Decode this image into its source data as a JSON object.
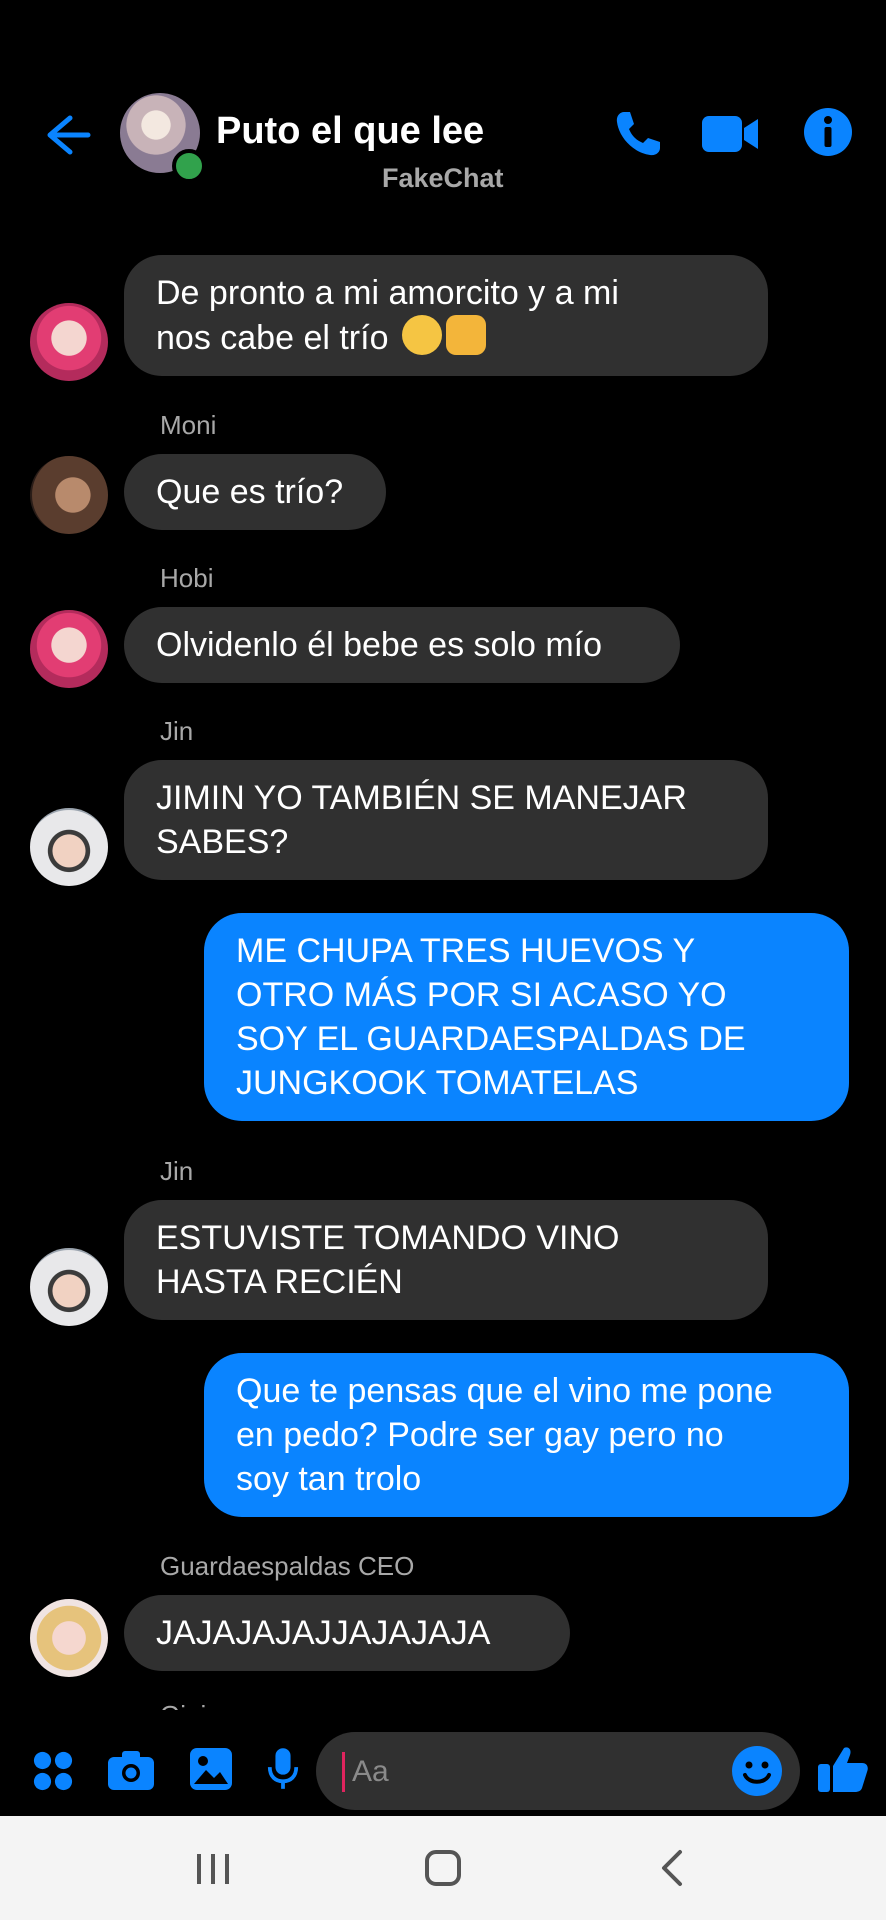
{
  "header": {
    "title": "Puto el que lee",
    "subtitle": "FakeChat"
  },
  "messages": [
    {
      "dir": "in",
      "sender": "",
      "lines": [
        "De pronto a mi amorcito y a mi",
        "nos cabe el trío"
      ],
      "emoji": [
        "pensive-face",
        "raised-fist"
      ]
    },
    {
      "dir": "in",
      "sender": "Moni",
      "lines": [
        "Que es trío?"
      ]
    },
    {
      "dir": "in",
      "sender": "Hobi",
      "lines": [
        "Olvidenlo él bebe es solo mío"
      ]
    },
    {
      "dir": "in",
      "sender": "Jin",
      "lines": [
        "JIMIN YO TAMBIÉN SE MANEJAR",
        "SABES?"
      ]
    },
    {
      "dir": "out",
      "lines": [
        "ME CHUPA TRES HUEVOS Y",
        "OTRO MÁS POR SI ACASO YO",
        "SOY EL GUARDAESPALDAS DE",
        "JUNGKOOK TOMATELAS"
      ]
    },
    {
      "dir": "in",
      "sender": "Jin",
      "lines": [
        "ESTUVISTE TOMANDO VINO",
        "HASTA RECIÉN"
      ]
    },
    {
      "dir": "out",
      "lines": [
        "Que te pensas que el vino me pone",
        "en pedo? Podre ser gay pero no",
        "soy tan trolo"
      ]
    },
    {
      "dir": "in",
      "sender": "Guardaespaldas CEO",
      "lines": [
        "JAJAJAJAJJAJAJAJA"
      ]
    },
    {
      "dir": "in",
      "sender": "Gigi",
      "lines": []
    }
  ],
  "composer": {
    "placeholder": "Aa"
  },
  "colors": {
    "accent": "#0a84ff",
    "incoming_bubble": "#303030",
    "online": "#31a24c"
  }
}
